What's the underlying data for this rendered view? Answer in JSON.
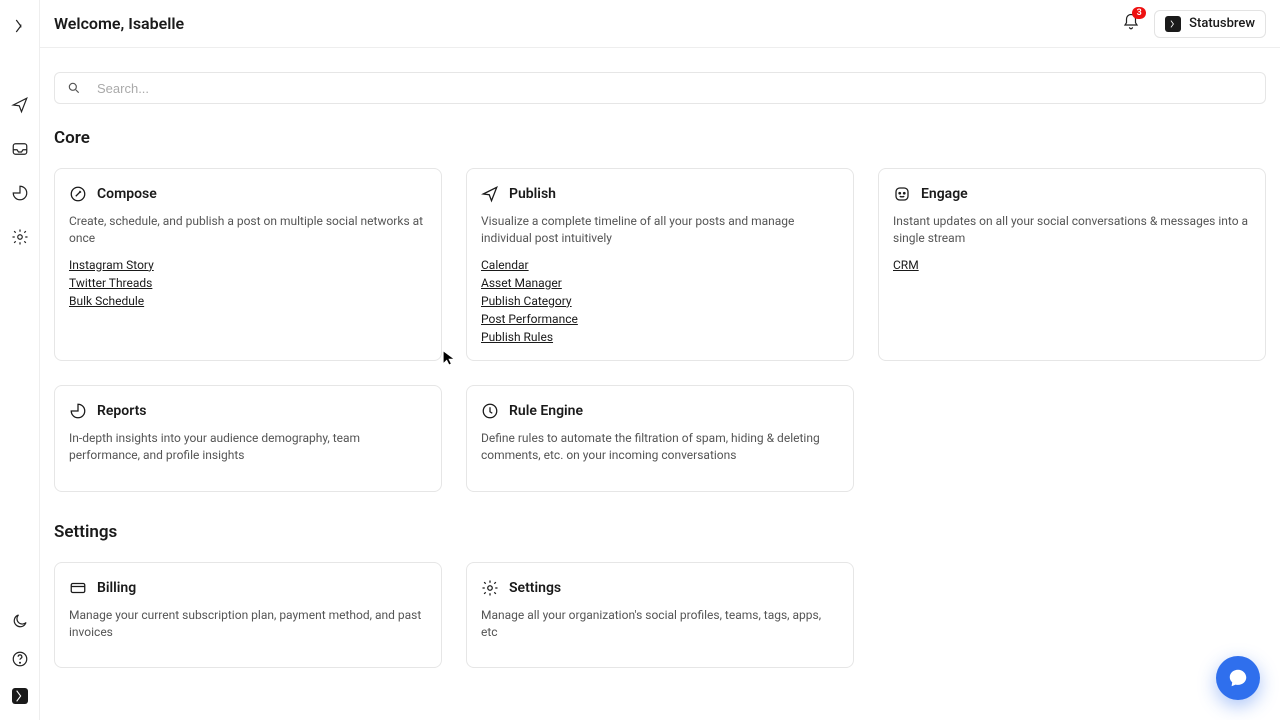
{
  "header": {
    "welcome": "Welcome, Isabelle",
    "brand": "Statusbrew",
    "notif_count": "3",
    "search_placeholder": "Search..."
  },
  "sections": {
    "core": "Core",
    "settings": "Settings"
  },
  "cards": {
    "compose": {
      "title": "Compose",
      "desc": "Create, schedule, and publish a post on multiple social networks at once",
      "links": [
        "Instagram Story",
        "Twitter Threads",
        "Bulk Schedule"
      ]
    },
    "publish": {
      "title": "Publish",
      "desc": "Visualize a complete timeline of all your posts and manage individual post intuitively",
      "links": [
        "Calendar",
        "Asset Manager",
        "Publish Category",
        "Post Performance",
        "Publish Rules"
      ]
    },
    "engage": {
      "title": "Engage",
      "desc": "Instant updates on all your social conversations & messages into a single stream",
      "links": [
        "CRM"
      ]
    },
    "reports": {
      "title": "Reports",
      "desc": "In-depth insights into your audience demography, team performance, and profile insights"
    },
    "rule": {
      "title": "Rule Engine",
      "desc": "Define rules to automate the filtration of spam, hiding & deleting comments, etc. on your incoming conversations"
    },
    "billing": {
      "title": "Billing",
      "desc": "Manage your current subscription plan, payment method, and past invoices"
    },
    "settings": {
      "title": "Settings",
      "desc": "Manage all your organization's social profiles, teams, tags, apps, etc"
    }
  }
}
